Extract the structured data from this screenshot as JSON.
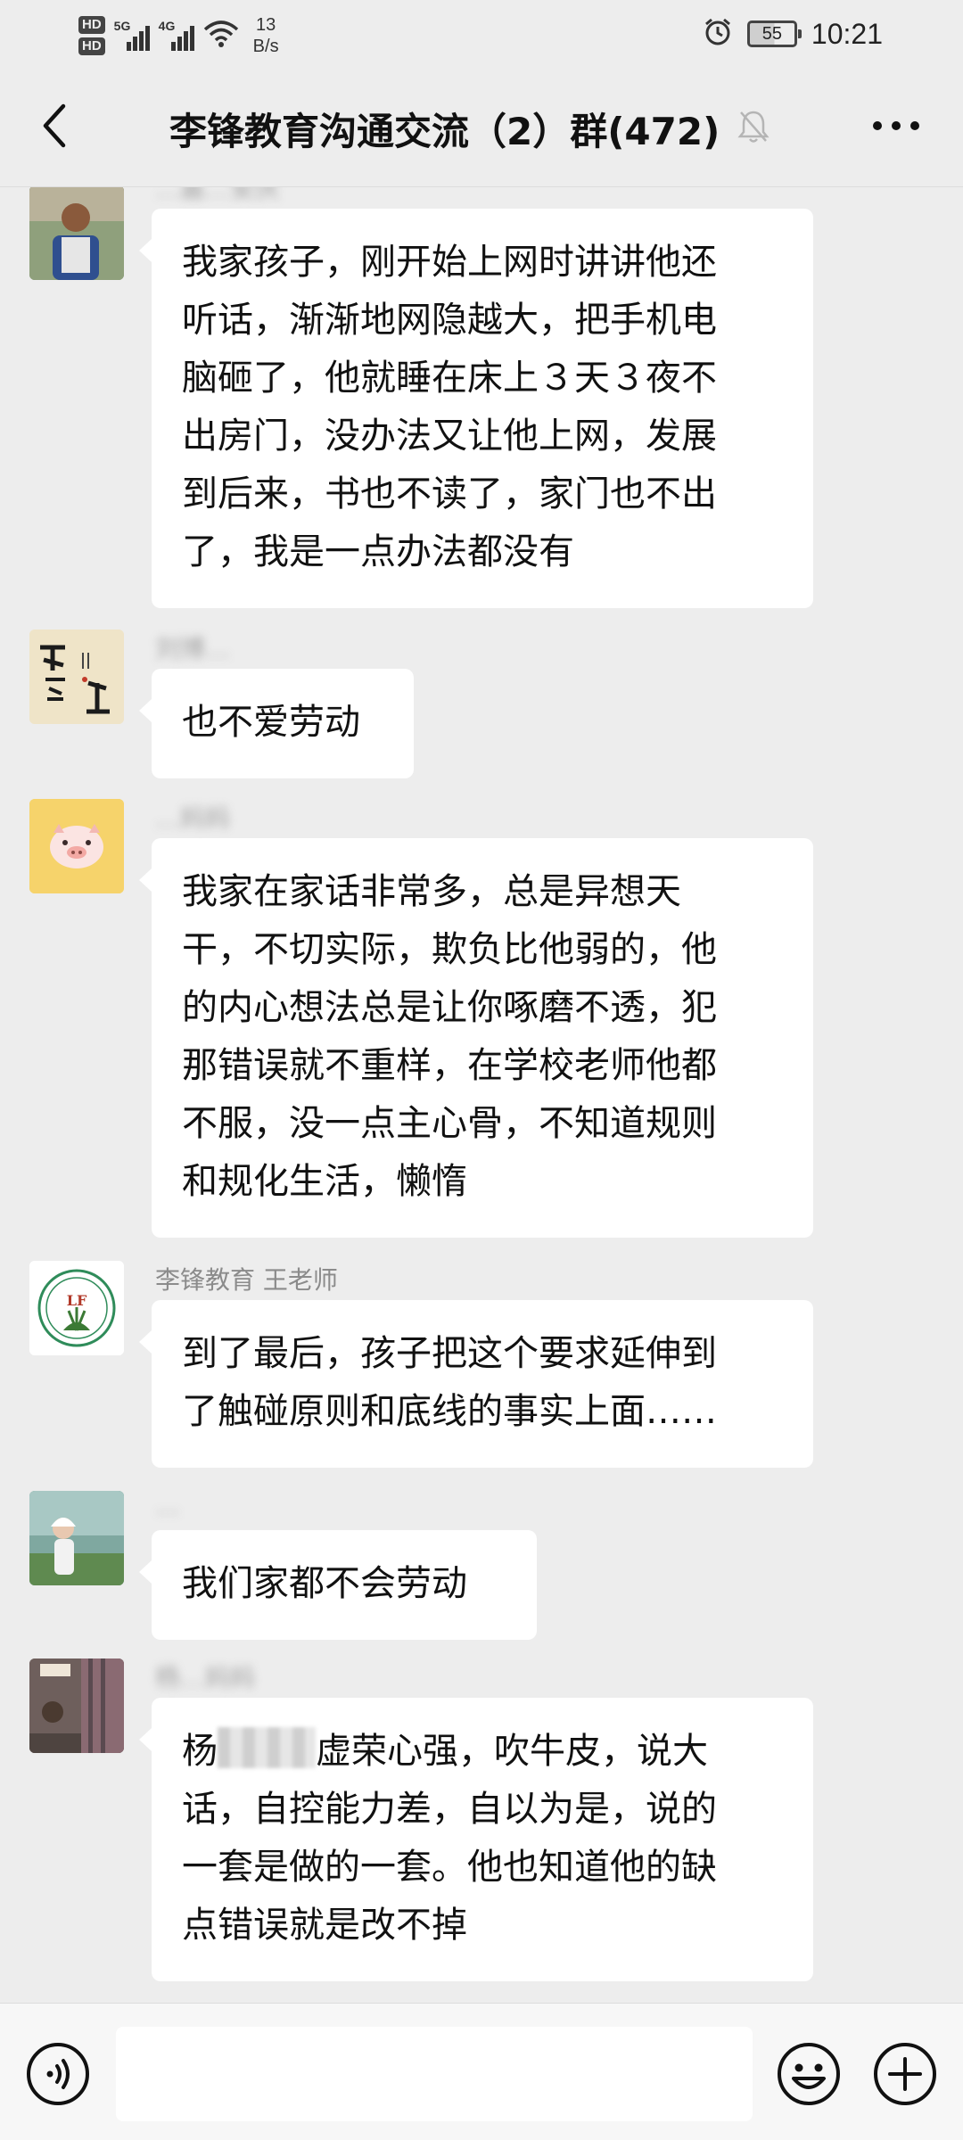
{
  "status_bar": {
    "hd1": "HD",
    "hd2": "HD",
    "net1": "5G",
    "net2": "4G",
    "speed_value": "13",
    "speed_unit": "B/s",
    "battery": "55",
    "time": "10:21"
  },
  "header": {
    "title": "李锋教育沟通交流（2）群(472)"
  },
  "messages": [
    {
      "sender": "…嘉…安庆",
      "lines": [
        "我家孩子，刚开始上网时讲讲他还",
        "听话，渐渐地网隐越大，把手机电",
        "脑砸了，他就睡在床上３天３夜不",
        "出房门，没办法又让他上网，发展",
        "到后来，书也不读了，家门也不出",
        "了，我是一点办法都没有"
      ]
    },
    {
      "sender": "刘博…",
      "lines": [
        "也不爱劳动"
      ]
    },
    {
      "sender": "…妈妈",
      "lines": [
        "我家在家话非常多，总是异想天",
        "干，不切实际，欺负比他弱的，他",
        "的内心想法总是让你啄磨不透，犯",
        "那错误就不重样，在学校老师他都",
        "不服，没一点主心骨，不知道规则",
        "和规化生活，懒惰"
      ]
    },
    {
      "sender": "李锋教育 王老师",
      "lines": [
        "到了最后，孩子把这个要求延伸到",
        "了触碰原则和底线的事实上面……"
      ]
    },
    {
      "sender": "…",
      "lines": [
        "我们家都不会劳动"
      ]
    },
    {
      "sender": "杨…妈妈",
      "lines": [
        "杨",
        "虚荣心强，吹牛皮，说大",
        "话，自控能力差，自以为是，说的",
        "一套是做的一套。他也知道他的缺",
        "点错误就是改不掉"
      ]
    }
  ],
  "avatars": {
    "a3_badge": "LF",
    "a2_text": "不忘初心 方得始终"
  }
}
